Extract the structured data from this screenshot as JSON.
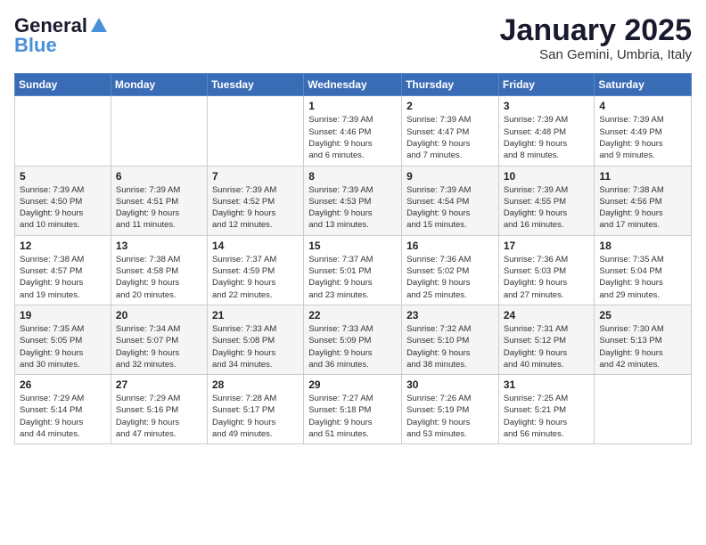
{
  "logo": {
    "line1": "General",
    "line2": "Blue"
  },
  "title": "January 2025",
  "location": "San Gemini, Umbria, Italy",
  "weekdays": [
    "Sunday",
    "Monday",
    "Tuesday",
    "Wednesday",
    "Thursday",
    "Friday",
    "Saturday"
  ],
  "weeks": [
    [
      {
        "day": "",
        "info": ""
      },
      {
        "day": "",
        "info": ""
      },
      {
        "day": "",
        "info": ""
      },
      {
        "day": "1",
        "info": "Sunrise: 7:39 AM\nSunset: 4:46 PM\nDaylight: 9 hours\nand 6 minutes."
      },
      {
        "day": "2",
        "info": "Sunrise: 7:39 AM\nSunset: 4:47 PM\nDaylight: 9 hours\nand 7 minutes."
      },
      {
        "day": "3",
        "info": "Sunrise: 7:39 AM\nSunset: 4:48 PM\nDaylight: 9 hours\nand 8 minutes."
      },
      {
        "day": "4",
        "info": "Sunrise: 7:39 AM\nSunset: 4:49 PM\nDaylight: 9 hours\nand 9 minutes."
      }
    ],
    [
      {
        "day": "5",
        "info": "Sunrise: 7:39 AM\nSunset: 4:50 PM\nDaylight: 9 hours\nand 10 minutes."
      },
      {
        "day": "6",
        "info": "Sunrise: 7:39 AM\nSunset: 4:51 PM\nDaylight: 9 hours\nand 11 minutes."
      },
      {
        "day": "7",
        "info": "Sunrise: 7:39 AM\nSunset: 4:52 PM\nDaylight: 9 hours\nand 12 minutes."
      },
      {
        "day": "8",
        "info": "Sunrise: 7:39 AM\nSunset: 4:53 PM\nDaylight: 9 hours\nand 13 minutes."
      },
      {
        "day": "9",
        "info": "Sunrise: 7:39 AM\nSunset: 4:54 PM\nDaylight: 9 hours\nand 15 minutes."
      },
      {
        "day": "10",
        "info": "Sunrise: 7:39 AM\nSunset: 4:55 PM\nDaylight: 9 hours\nand 16 minutes."
      },
      {
        "day": "11",
        "info": "Sunrise: 7:38 AM\nSunset: 4:56 PM\nDaylight: 9 hours\nand 17 minutes."
      }
    ],
    [
      {
        "day": "12",
        "info": "Sunrise: 7:38 AM\nSunset: 4:57 PM\nDaylight: 9 hours\nand 19 minutes."
      },
      {
        "day": "13",
        "info": "Sunrise: 7:38 AM\nSunset: 4:58 PM\nDaylight: 9 hours\nand 20 minutes."
      },
      {
        "day": "14",
        "info": "Sunrise: 7:37 AM\nSunset: 4:59 PM\nDaylight: 9 hours\nand 22 minutes."
      },
      {
        "day": "15",
        "info": "Sunrise: 7:37 AM\nSunset: 5:01 PM\nDaylight: 9 hours\nand 23 minutes."
      },
      {
        "day": "16",
        "info": "Sunrise: 7:36 AM\nSunset: 5:02 PM\nDaylight: 9 hours\nand 25 minutes."
      },
      {
        "day": "17",
        "info": "Sunrise: 7:36 AM\nSunset: 5:03 PM\nDaylight: 9 hours\nand 27 minutes."
      },
      {
        "day": "18",
        "info": "Sunrise: 7:35 AM\nSunset: 5:04 PM\nDaylight: 9 hours\nand 29 minutes."
      }
    ],
    [
      {
        "day": "19",
        "info": "Sunrise: 7:35 AM\nSunset: 5:05 PM\nDaylight: 9 hours\nand 30 minutes."
      },
      {
        "day": "20",
        "info": "Sunrise: 7:34 AM\nSunset: 5:07 PM\nDaylight: 9 hours\nand 32 minutes."
      },
      {
        "day": "21",
        "info": "Sunrise: 7:33 AM\nSunset: 5:08 PM\nDaylight: 9 hours\nand 34 minutes."
      },
      {
        "day": "22",
        "info": "Sunrise: 7:33 AM\nSunset: 5:09 PM\nDaylight: 9 hours\nand 36 minutes."
      },
      {
        "day": "23",
        "info": "Sunrise: 7:32 AM\nSunset: 5:10 PM\nDaylight: 9 hours\nand 38 minutes."
      },
      {
        "day": "24",
        "info": "Sunrise: 7:31 AM\nSunset: 5:12 PM\nDaylight: 9 hours\nand 40 minutes."
      },
      {
        "day": "25",
        "info": "Sunrise: 7:30 AM\nSunset: 5:13 PM\nDaylight: 9 hours\nand 42 minutes."
      }
    ],
    [
      {
        "day": "26",
        "info": "Sunrise: 7:29 AM\nSunset: 5:14 PM\nDaylight: 9 hours\nand 44 minutes."
      },
      {
        "day": "27",
        "info": "Sunrise: 7:29 AM\nSunset: 5:16 PM\nDaylight: 9 hours\nand 47 minutes."
      },
      {
        "day": "28",
        "info": "Sunrise: 7:28 AM\nSunset: 5:17 PM\nDaylight: 9 hours\nand 49 minutes."
      },
      {
        "day": "29",
        "info": "Sunrise: 7:27 AM\nSunset: 5:18 PM\nDaylight: 9 hours\nand 51 minutes."
      },
      {
        "day": "30",
        "info": "Sunrise: 7:26 AM\nSunset: 5:19 PM\nDaylight: 9 hours\nand 53 minutes."
      },
      {
        "day": "31",
        "info": "Sunrise: 7:25 AM\nSunset: 5:21 PM\nDaylight: 9 hours\nand 56 minutes."
      },
      {
        "day": "",
        "info": ""
      }
    ]
  ]
}
